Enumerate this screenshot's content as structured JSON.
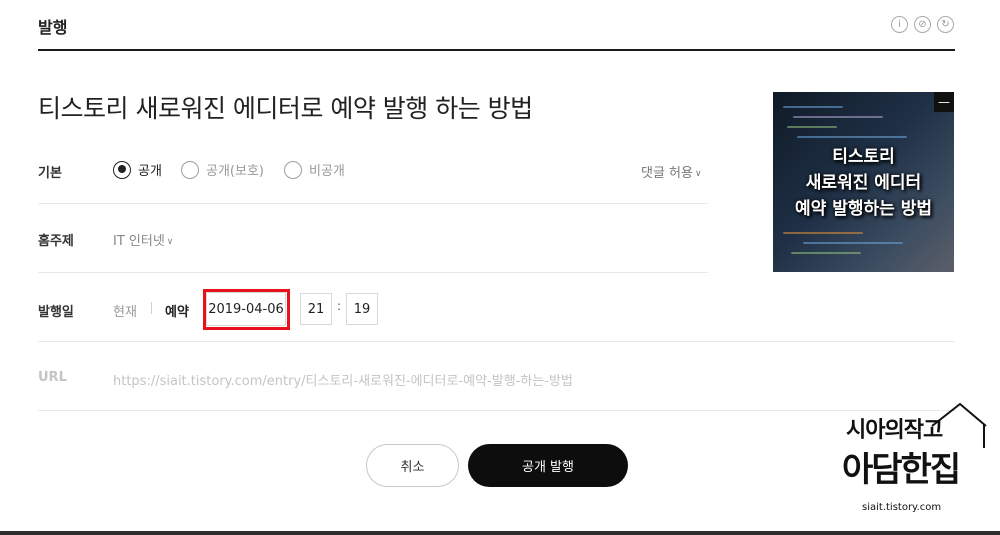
{
  "header": {
    "title": "발행",
    "icons": [
      "info-icon",
      "no-ads-icon",
      "refresh-icon"
    ]
  },
  "post": {
    "title": "티스토리 새로워진 에디터로 예약 발행 하는 방법"
  },
  "visibility": {
    "label": "기본",
    "options": [
      "공개",
      "공개(보호)",
      "비공개"
    ],
    "selected": "공개",
    "comment_setting": "댓글 허용"
  },
  "category": {
    "label": "홈주제",
    "value": "IT 인터넷"
  },
  "publish_date": {
    "label": "발행일",
    "option_now": "현재",
    "option_reserve": "예약",
    "date": "2019-04-06",
    "hour": "21",
    "minute": "19",
    "separator": ":"
  },
  "url": {
    "label": "URL",
    "value": "https://siait.tistory.com/entry/티스토리-새로워진-에디터로-예약-발행-하는-방법"
  },
  "thumbnail": {
    "text_line1": "티스토리",
    "text_line2": "새로워진 에디터",
    "text_line3": "예약 발행하는 방법",
    "remove_label": "—"
  },
  "actions": {
    "cancel": "취소",
    "publish": "공개 발행"
  },
  "watermark": {
    "line1": "시아의작고",
    "line2": "아담한집",
    "url": "siait.tistory.com"
  },
  "colors": {
    "highlight": "#e8121b",
    "primary_button": "#0d0d0d"
  }
}
